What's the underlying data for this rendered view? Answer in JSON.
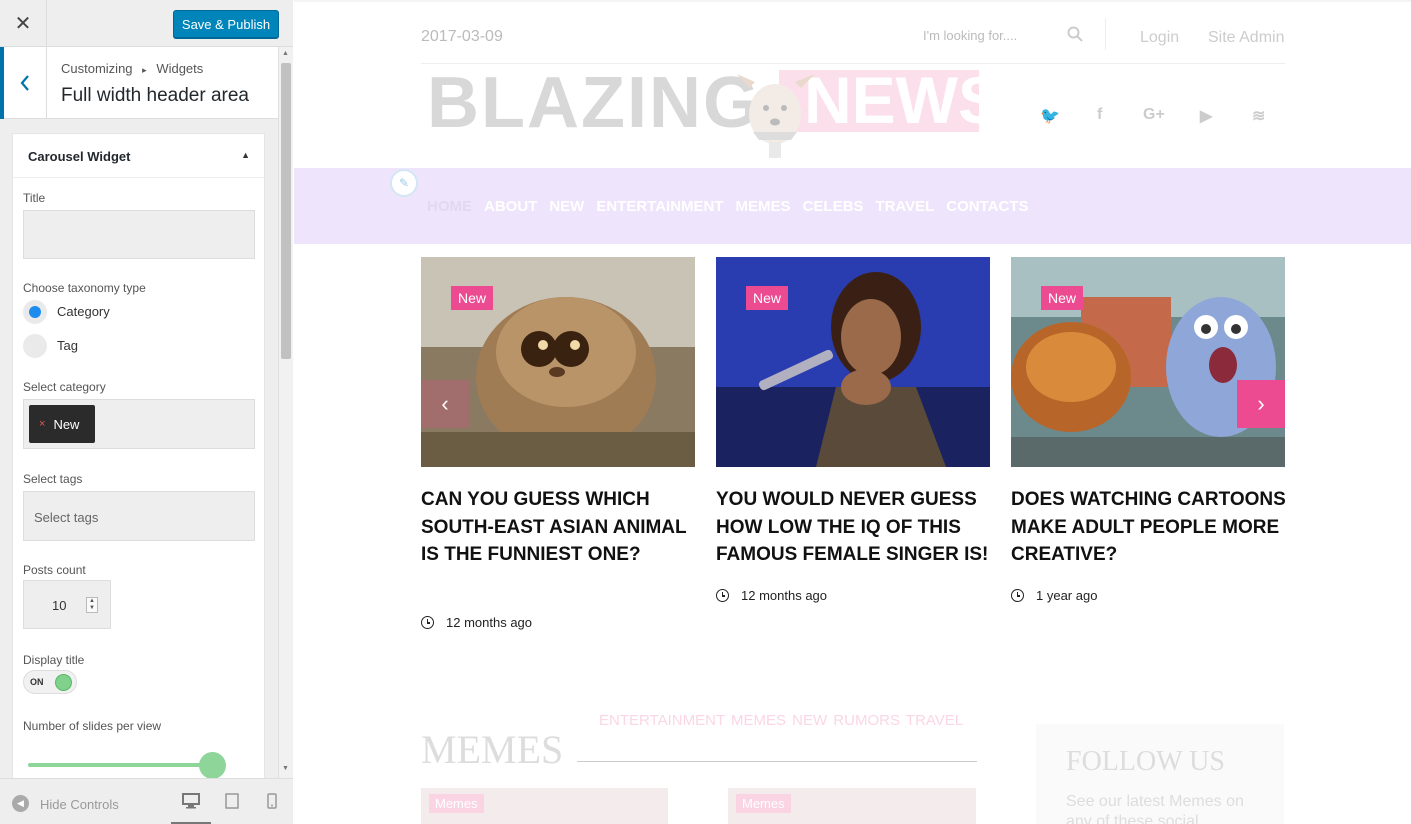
{
  "panel": {
    "close_glyph": "✕",
    "save_label": "Save & Publish",
    "breadcrumb_root": "Customizing",
    "breadcrumb_sep": "▸",
    "breadcrumb_leaf": "Widgets",
    "section_title": "Full width header area",
    "widget_title": "Carousel Widget",
    "fields": {
      "title_label": "Title",
      "title_value": "",
      "taxonomy_label": "Choose taxonomy type",
      "taxonomy_options": [
        "Category",
        "Tag"
      ],
      "taxonomy_selected": "Category",
      "category_label": "Select category",
      "category_chip": "New",
      "category_chip_remove": "×",
      "tags_label": "Select tags",
      "tags_placeholder": "Select tags",
      "posts_count_label": "Posts count",
      "posts_count_value": "10",
      "display_title_label": "Display title",
      "display_title_state": "ON",
      "slides_label": "Number of slides per view"
    },
    "bottom": {
      "hide_controls": "Hide Controls",
      "devices": [
        "desktop-icon",
        "tablet-icon",
        "mobile-icon"
      ]
    }
  },
  "preview": {
    "date": "2017-03-09",
    "search_placeholder": "I'm looking for....",
    "login": "Login",
    "site_admin": "Site Admin",
    "logo_left": "BLAZING",
    "logo_right": "NEWS",
    "social_glyphs": [
      "🐦",
      "f",
      "G+",
      "▶",
      "≋"
    ],
    "nav": [
      "HOME",
      "ABOUT",
      "NEW",
      "ENTERTAINMENT",
      "MEMES",
      "CELEBS",
      "TRAVEL",
      "CONTACTS"
    ],
    "pencil_glyph": "✎",
    "prev_glyph": "‹",
    "next_glyph": "›",
    "cards": [
      {
        "badge": "New",
        "title": "CAN YOU GUESS WHICH SOUTH-EAST ASIAN ANIMAL IS THE FUNNIEST ONE?",
        "time": "12 months ago"
      },
      {
        "badge": "New",
        "title": "YOU WOULD NEVER GUESS HOW LOW THE IQ OF THIS FAMOUS FEMALE SINGER IS!",
        "time": "12 months ago"
      },
      {
        "badge": "New",
        "title": "DOES WATCHING CARTOONS MAKE ADULT PEOPLE MORE CREATIVE?",
        "time": "1 year ago"
      }
    ],
    "section_cats": "ENTERTAINMENT MEMES NEW RUMORS TRAVEL",
    "memes_heading": "MEMES",
    "thumb_badges": [
      "Memes",
      "Memes"
    ],
    "follow_title": "FOLLOW US",
    "follow_text": "See our latest Memes on any of these social"
  },
  "colors": {
    "accent": "#0085ba",
    "brand_pink": "#ec4b91",
    "nav_bg": "#eee4fc",
    "toggle_green": "#7fd18b"
  },
  "slider_fraction": 1.0
}
